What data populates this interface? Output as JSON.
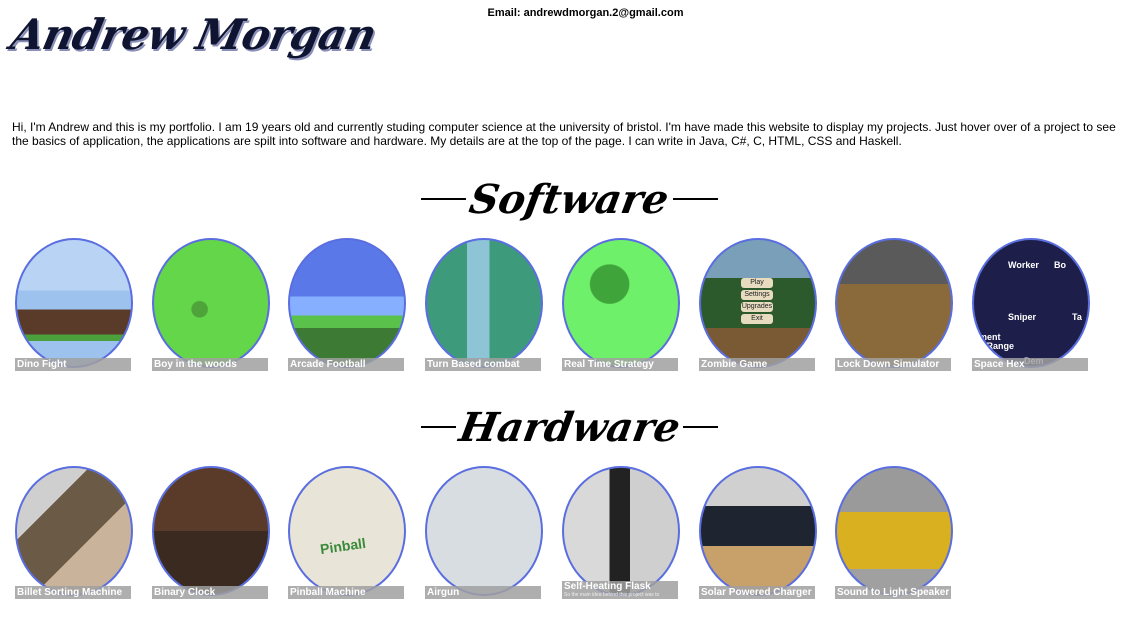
{
  "header": {
    "name": "Andrew Morgan",
    "email_label": "Email: andrewdmorgan.2@gmail.com"
  },
  "intro": "Hi, I'm Andrew and this is my portfolio. I am 19 years old and currently studing computer science at the university of bristol. I'm have made this website to display my projects. Just hover over of a project to see the basics of application, the applications are spilt into software and hardware. My details are at the top of the page. I can write in Java, C#, C, HTML, CSS and Haskell.",
  "software": {
    "heading": "Software",
    "projects": [
      {
        "title": "Dino Fight",
        "thumb": "t-dino"
      },
      {
        "title": "Boy in the woods",
        "thumb": "t-boy"
      },
      {
        "title": "Arcade Football",
        "thumb": "t-arcade"
      },
      {
        "title": "Turn Based combat",
        "thumb": "t-turn"
      },
      {
        "title": "Real Time Strategy",
        "thumb": "t-rts"
      },
      {
        "title": "Zombie Game",
        "thumb": "t-zombie"
      },
      {
        "title": "Lock Down Simulator",
        "thumb": "t-lock"
      },
      {
        "title": "Space Hex",
        "thumb": "t-space"
      }
    ]
  },
  "hardware": {
    "heading": "Hardware",
    "projects": [
      {
        "title": "Billet Sorting Machine",
        "thumb": "t-billet"
      },
      {
        "title": "Binary Clock",
        "thumb": "t-binary"
      },
      {
        "title": "Pinball Machine",
        "thumb": "t-pinball"
      },
      {
        "title": "Airgun",
        "thumb": "t-airgun"
      },
      {
        "title": "Self-Heating Flask",
        "thumb": "t-flask",
        "subtitle": "So the main idea behind this project was to"
      },
      {
        "title": "Solar Powered Charger",
        "thumb": "t-solar"
      },
      {
        "title": "Sound to Light Speaker",
        "thumb": "t-sound"
      }
    ]
  },
  "zombie_menu": [
    "Play",
    "Settings",
    "Upgrades",
    "Exit"
  ],
  "space_hex_labels": [
    "Worker",
    "Sniper",
    "er",
    "Bo",
    "Ta",
    "ement",
    "ck Range",
    "Dem"
  ],
  "pinball_logo": "Pinball",
  "colors": {
    "circle_border": "#5a6ee0",
    "caption_bg": "#a0a0a0"
  }
}
